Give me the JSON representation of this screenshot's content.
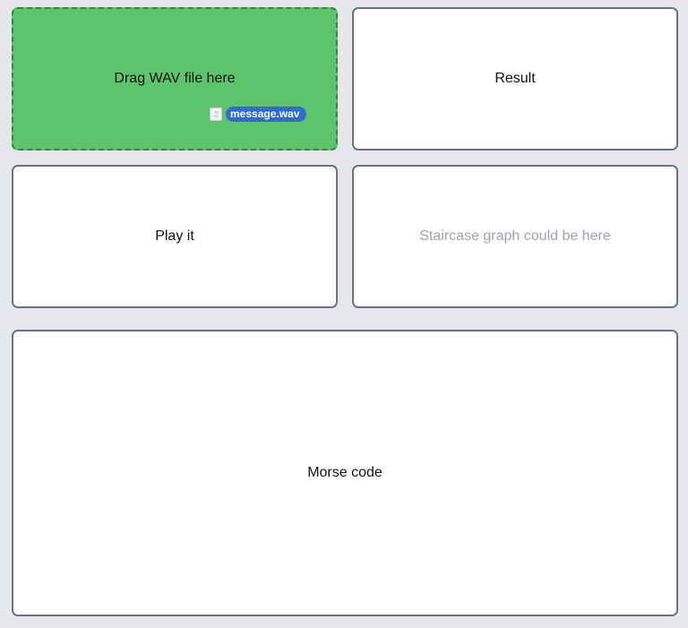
{
  "panels": {
    "drop_zone": {
      "label": "Drag WAV file here",
      "bg_color": "#5ec46b",
      "dragged_file": {
        "name": "message.wav",
        "icon": "audio-file-icon",
        "icon_glyph": "♫"
      }
    },
    "result": {
      "label": "Result"
    },
    "play": {
      "label": "Play it"
    },
    "graph": {
      "placeholder": "Staircase graph could be here"
    },
    "morse": {
      "label": "Morse code"
    }
  },
  "colors": {
    "page_bg": "#e5e7eb",
    "panel_border": "#6b7280",
    "drag_pill": "#2f6bd1",
    "placeholder_text": "#9ca3af"
  }
}
